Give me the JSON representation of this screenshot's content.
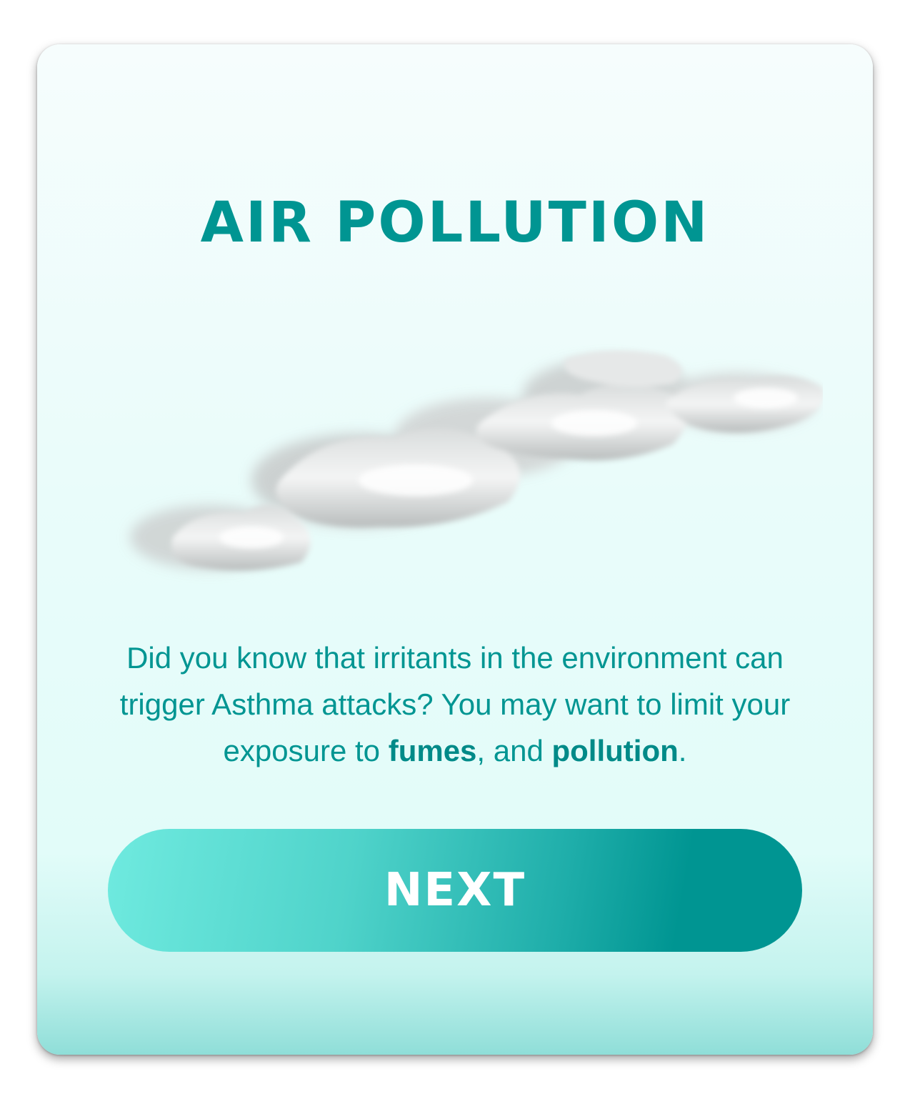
{
  "card": {
    "title": "AIR POLLUTION",
    "illustration": "smoke-cloud-illustration",
    "message": {
      "part1": "Did you know that irritants in the environment can trigger Asthma attacks? You may want to limit your exposure to ",
      "bold1": "fumes",
      "part2": ", and ",
      "bold2": "pollution",
      "part3": "."
    },
    "next_label": "NEXT"
  },
  "colors": {
    "accent": "#009592",
    "button_gradient_start": "#6feadf",
    "button_gradient_end": "#009592",
    "card_bottom": "#8fded8"
  }
}
